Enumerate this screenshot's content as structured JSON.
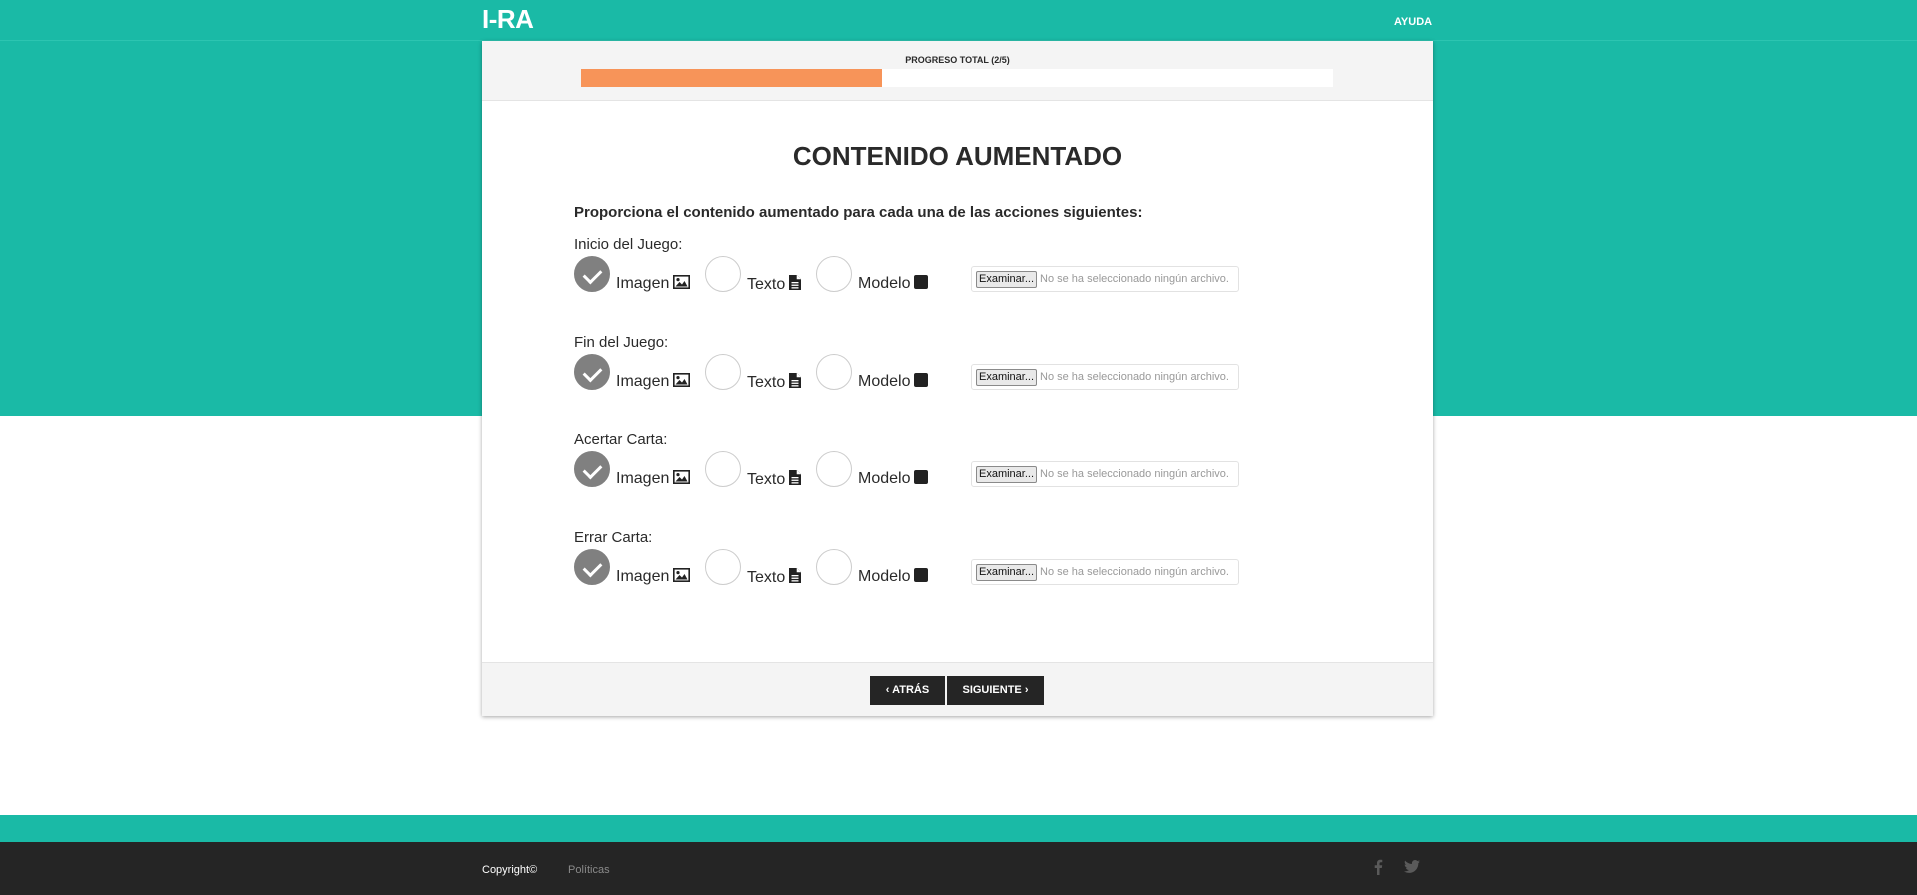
{
  "header": {
    "logo": "I-RA",
    "help_link": "AYUDA"
  },
  "progress": {
    "label": "PROGRESO TOTAL (2/5)",
    "fraction": 0.4,
    "fill_color": "#f79459"
  },
  "page": {
    "title": "CONTENIDO AUMENTADO",
    "instruction": "Proporciona el contenido aumentado para cada una de las acciones siguientes:"
  },
  "options": {
    "image_label": "Imagen",
    "text_label": "Texto",
    "model_label": "Modelo"
  },
  "file_input": {
    "button_label": "Examinar...",
    "status_text": "No se ha seleccionado ningún archivo."
  },
  "actions": [
    {
      "label": "Inicio del Juego:",
      "selected": "Imagen"
    },
    {
      "label": "Fin del Juego:",
      "selected": "Imagen"
    },
    {
      "label": "Acertar Carta:",
      "selected": "Imagen"
    },
    {
      "label": "Errar Carta:",
      "selected": "Imagen"
    }
  ],
  "nav": {
    "back_label": "ATRÁS",
    "next_label": "SIGUIENTE"
  },
  "footer": {
    "copyright": "Copyright©",
    "policies": "Políticas"
  },
  "icons": {
    "back": "chevron-left-icon",
    "next": "chevron-right-icon",
    "image": "image-icon",
    "text": "document-icon",
    "model": "cube-icon",
    "facebook": "facebook-icon",
    "twitter": "twitter-icon"
  },
  "colors": {
    "teal": "#1abaa6",
    "dark": "#252525",
    "progress": "#f79459",
    "checked": "#808080"
  }
}
